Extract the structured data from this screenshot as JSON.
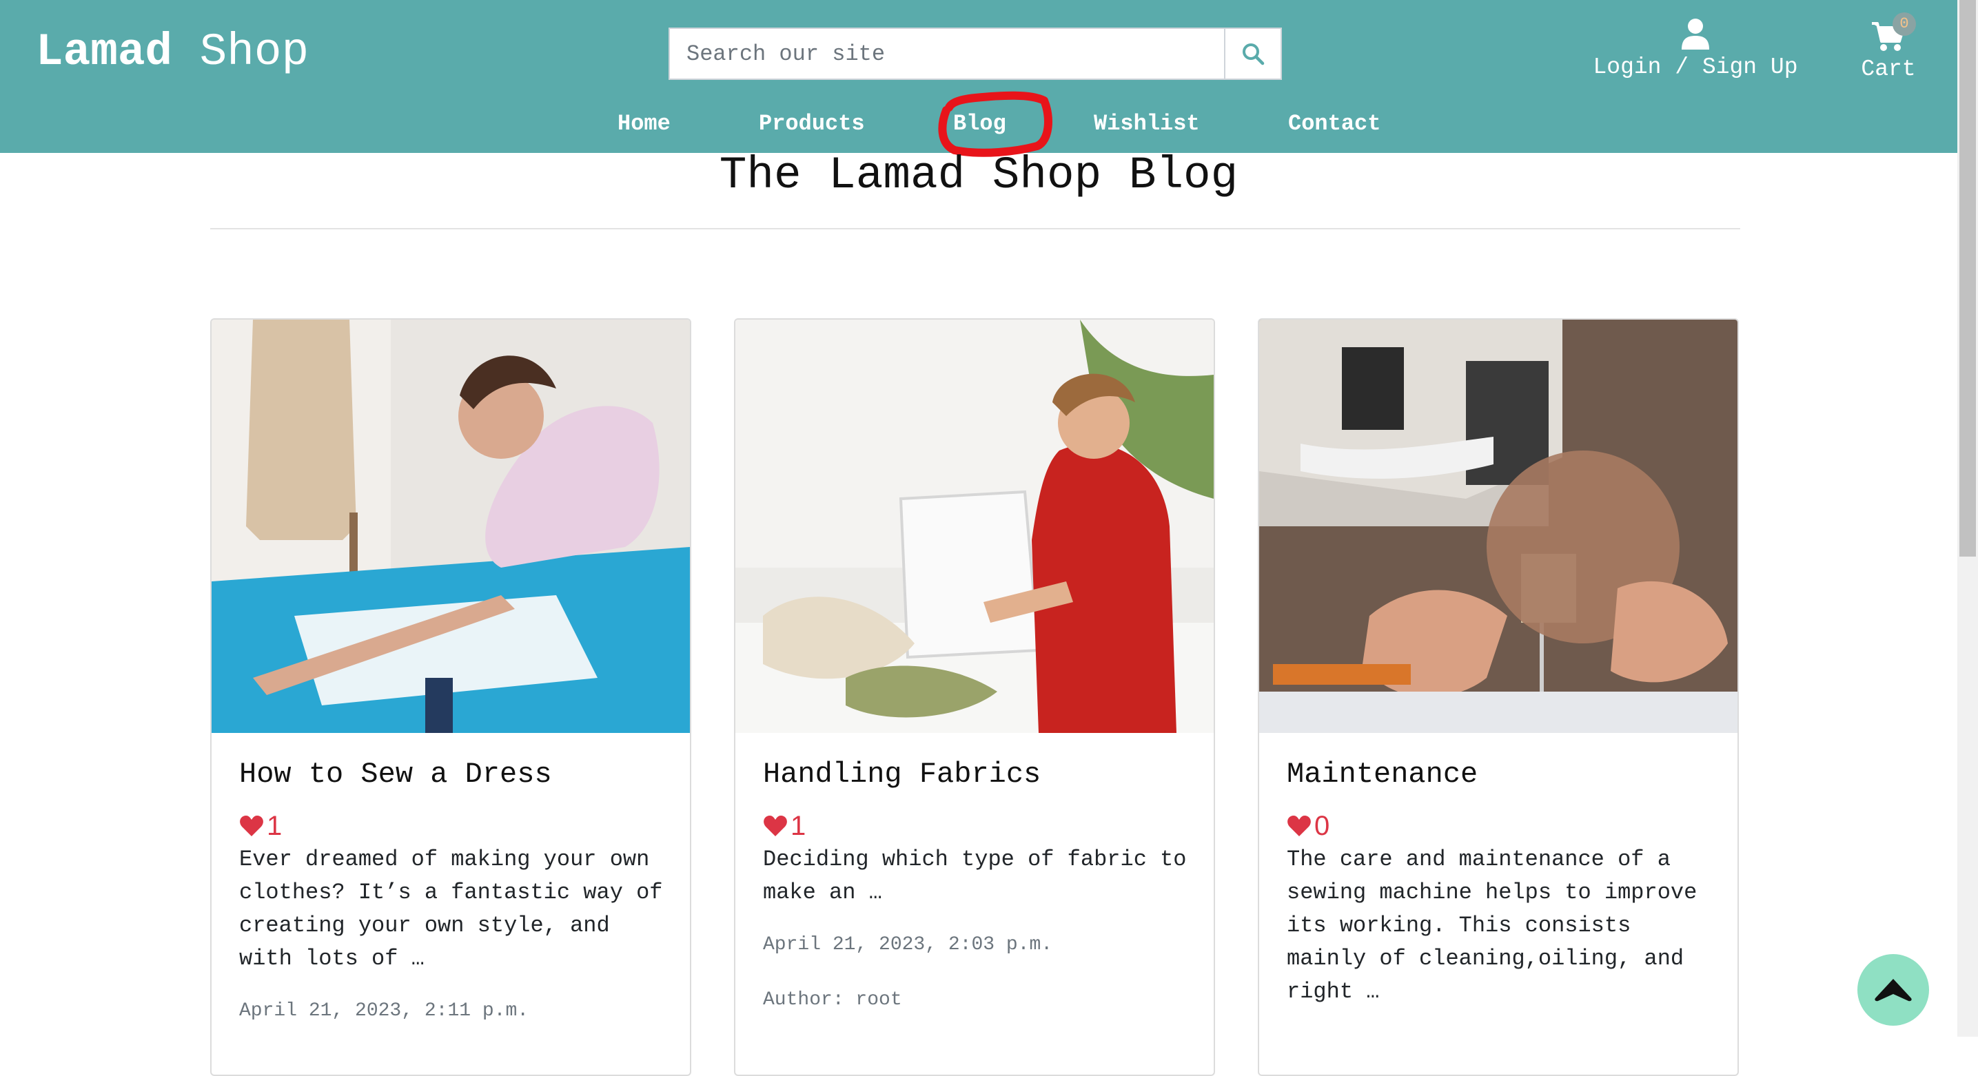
{
  "brand": {
    "part1": "Lamad",
    "part2": "Shop"
  },
  "search": {
    "placeholder": "Search our site",
    "value": ""
  },
  "account": {
    "label": "Login / Sign Up"
  },
  "cart": {
    "label": "Cart",
    "count": "0"
  },
  "nav": {
    "home": "Home",
    "products": "Products",
    "blog": "Blog",
    "wishlist": "Wishlist",
    "contact": "Contact"
  },
  "page": {
    "title": "The Lamad Shop Blog"
  },
  "posts": [
    {
      "title": "How to Sew a Dress",
      "likes": "1",
      "excerpt": "Ever dreamed of making your own clothes? It’s a fantastic way of creating your own style, and with lots of …",
      "date": "April 21, 2023, 2:11 p.m.",
      "image": "woman-cutting-fabric-photo"
    },
    {
      "title": "Handling Fabrics",
      "likes": "1",
      "excerpt": "Deciding which type of fabric to make an …",
      "date": "April 21, 2023, 2:03 p.m.",
      "author": "Author: root",
      "image": "woman-at-sewing-machine-photo"
    },
    {
      "title": "Maintenance",
      "likes": "0",
      "excerpt": "The care and maintenance of a sewing machine helps to improve its working. This consists mainly of cleaning,oiling, and right …",
      "image": "sewing-machine-closeup-photo"
    }
  ],
  "colors": {
    "navbar": "#5aabab",
    "heart": "#dc3545",
    "to_top": "#8fe0c3",
    "annotation": "#e8141a"
  }
}
